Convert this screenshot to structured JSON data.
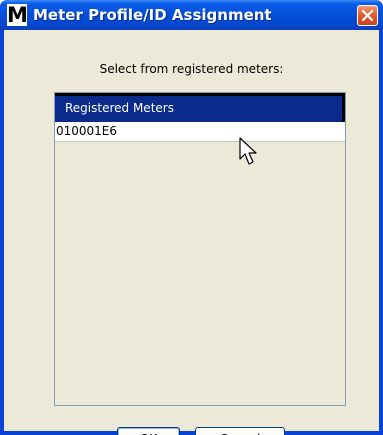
{
  "window": {
    "icon_letter": "M",
    "title": "Meter Profile/ID Assignment"
  },
  "dialog": {
    "prompt": "Select from registered meters:"
  },
  "meters_list": {
    "header": "Registered Meters",
    "rows": [
      "010001E6"
    ]
  },
  "buttons": {
    "ok_label": "OK",
    "cancel_label": "Cancel"
  },
  "colors": {
    "titlebar": "#0550dc",
    "list_header": "#0a2a8c",
    "dialog_bg": "#ece9d8",
    "close_button": "#e05a2a"
  }
}
